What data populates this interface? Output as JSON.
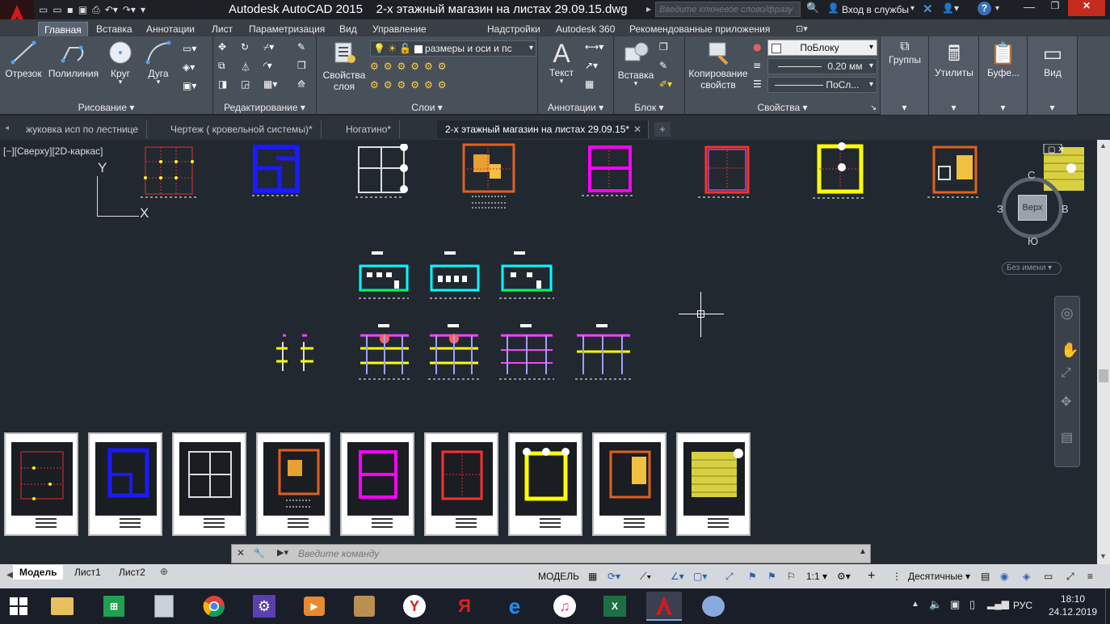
{
  "title_bar": {
    "app_title": "Autodesk AutoCAD 2015",
    "file_title": "2-х этажный магазин на листах 29.09.15.dwg",
    "search_placeholder": "Введите ключевое слово/фразу",
    "signin_label": "Вход в службы"
  },
  "ribbon_tabs": [
    "Главная",
    "Вставка",
    "Аннотации",
    "Лист",
    "Параметризация",
    "Вид",
    "Управление",
    "Надстройки",
    "Autodesk 360",
    "Рекомендованные приложения"
  ],
  "ribbon": {
    "draw": {
      "title": "Рисование",
      "line": "Отрезок",
      "polyline": "Полилиния",
      "circle": "Круг",
      "arc": "Дуга"
    },
    "modify": {
      "title": "Редактирование"
    },
    "layers": {
      "title": "Слои",
      "props": "Свойства",
      "props2": "слоя",
      "current_layer": "размеры и оси и пс"
    },
    "annotation": {
      "title": "Аннотации",
      "text": "Текст"
    },
    "block": {
      "title": "Блок",
      "insert": "Вставка"
    },
    "properties": {
      "title": "Свойства",
      "copy": "Копирование",
      "copy2": "свойств",
      "color": "ПоБлоку",
      "lineweight": "0.20 мм",
      "linetype": "ПоСл..."
    },
    "groups": "Группы",
    "utilities": "Утилиты",
    "clipboard": "Буфе...",
    "view": "Вид"
  },
  "doc_tabs": [
    "жуковка исп по лестнице",
    "Чертеж ( кровельной системы)*",
    "Ногатино*",
    "2-х этажный магазин на листах 29.09.15*"
  ],
  "viewport": {
    "view_label": "[−][Сверху][2D-каркас]",
    "ucs_y": "Y",
    "ucs_x": "X",
    "viewcube": {
      "top": "Верх",
      "n": "С",
      "s": "Ю",
      "w": "З",
      "e": "В"
    },
    "named_view": "Без имени"
  },
  "command": {
    "placeholder": "Введите команду"
  },
  "layout_tabs": [
    "Модель",
    "Лист1",
    "Лист2"
  ],
  "status": {
    "model": "МОДЕЛЬ",
    "scale": "1:1",
    "units": "Десятичные"
  },
  "taskbar": {
    "lang": "РУС",
    "time": "18:10",
    "date": "24.12.2019"
  },
  "colors": {
    "magenta": "#ff00ff",
    "blue": "#0000ff",
    "yellow": "#ffff00",
    "cyan": "#00ffff",
    "red": "#ff3030",
    "accent": "#c00000"
  }
}
